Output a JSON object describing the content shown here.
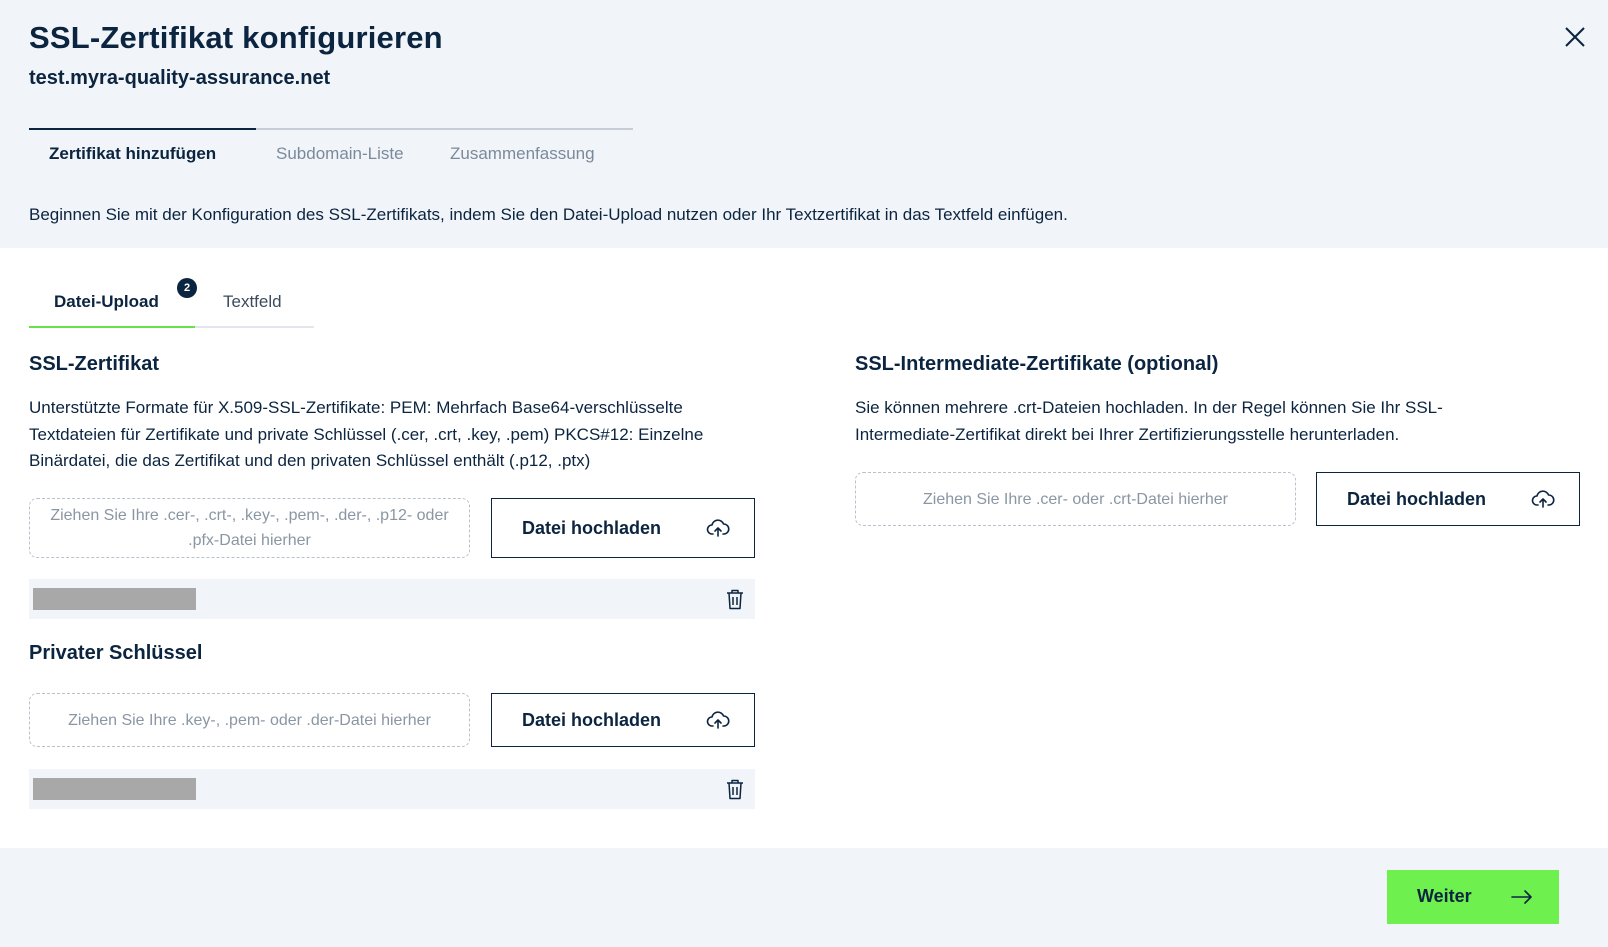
{
  "dialog": {
    "title": "SSL-Zertifikat konfigurieren",
    "domain": "test.myra-quality-assurance.net",
    "close_icon": "close-icon"
  },
  "steps": [
    {
      "label": "Zertifikat hinzufügen",
      "active": true
    },
    {
      "label": "Subdomain-Liste",
      "active": false
    },
    {
      "label": "Zusammenfassung",
      "active": false
    }
  ],
  "intro": "Beginnen Sie mit der Konfiguration des SSL-Zertifikats, indem Sie den Datei-Upload nutzen oder Ihr Textzertifikat in das Textfeld einfügen.",
  "subtabs": {
    "upload_label": "Datei-Upload",
    "upload_badge": "2",
    "text_label": "Textfeld"
  },
  "ssl_cert": {
    "title": "SSL-Zertifikat",
    "description": "Unterstützte Formate für X.509-SSL-Zertifikate: PEM: Mehrfach Base64-verschlüsselte Textdateien für Zertifikate und private Schlüssel (.cer, .crt, .key, .pem) PKCS#12: Einzelne Binärdatei, die das Zertifikat und den privaten Schlüssel enthält (.p12, .ptx)",
    "dropzone_placeholder": "Ziehen Sie Ihre .cer-, .crt-, .key-, .pem-, .der-, .p12- oder .pfx-Datei hierher",
    "upload_label": "Datei hochladen"
  },
  "private_key": {
    "title": "Privater Schlüssel",
    "dropzone_placeholder": "Ziehen Sie Ihre .key-, .pem- oder .der-Datei hierher",
    "upload_label": "Datei hochladen"
  },
  "intermediate": {
    "title": "SSL-Intermediate-Zertifikate (optional)",
    "description": "Sie können mehrere .crt-Dateien hochladen. In der Regel können Sie Ihr SSL-Intermediate-Zertifikat direkt bei Ihrer Zertifizierungsstelle herunterladen.",
    "dropzone_placeholder": "Ziehen Sie Ihre .cer- oder .crt-Datei hierher",
    "upload_label": "Datei hochladen"
  },
  "footer": {
    "next_label": "Weiter"
  },
  "colors": {
    "primary": "#0b2440",
    "accent_green": "#6ef04f",
    "tab_underline": "#67e04b",
    "background": "#f1f4f8"
  },
  "icons": {
    "upload": "cloud-upload-icon",
    "delete": "trash-icon",
    "next": "arrow-right-icon"
  }
}
